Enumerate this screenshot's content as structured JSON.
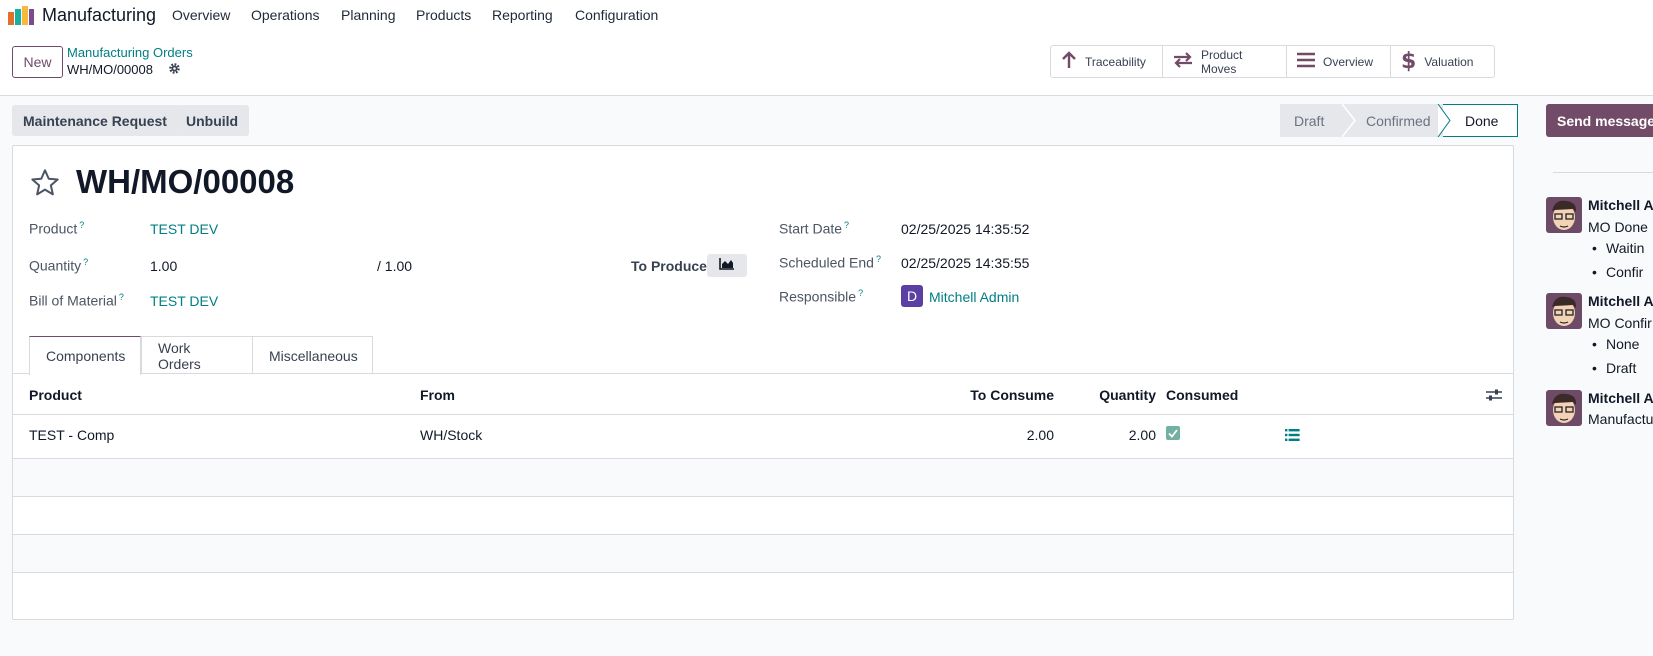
{
  "navbar": {
    "app_name": "Manufacturing",
    "menu": [
      "Overview",
      "Operations",
      "Planning",
      "Products",
      "Reporting",
      "Configuration"
    ]
  },
  "control_panel": {
    "new_label": "New",
    "breadcrumb_parent": "Manufacturing Orders",
    "breadcrumb_current": "WH/MO/00008",
    "smart_buttons": [
      {
        "label": "Traceability",
        "icon": "arrow-up-icon"
      },
      {
        "label": "Product Moves",
        "icon": "arrows-exchange-icon"
      },
      {
        "label": "Overview",
        "icon": "list-lines-icon"
      },
      {
        "label": "Valuation",
        "icon": "dollar-icon"
      }
    ]
  },
  "actions": {
    "maintenance_request": "Maintenance Request",
    "unbuild": "Unbuild",
    "send_message": "Send message"
  },
  "statusbar": {
    "stages": [
      "Draft",
      "Confirmed",
      "Done"
    ],
    "current": "Done"
  },
  "form": {
    "title": "WH/MO/00008",
    "product_label": "Product",
    "product_value": "TEST DEV",
    "quantity_label": "Quantity",
    "quantity_value": "1.00",
    "quantity_total": "/ 1.00",
    "to_produce_label": "To Produce",
    "bom_label": "Bill of Material",
    "bom_value": "TEST DEV",
    "start_date_label": "Start Date",
    "start_date_value": "02/25/2025 14:35:52",
    "scheduled_end_label": "Scheduled End",
    "scheduled_end_value": "02/25/2025 14:35:55",
    "responsible_label": "Responsible",
    "responsible_initial": "D",
    "responsible_value": "Mitchell Admin",
    "help_mark": "?"
  },
  "tabs": [
    "Components",
    "Work Orders",
    "Miscellaneous"
  ],
  "components_table": {
    "headers": [
      "Product",
      "From",
      "To Consume",
      "Quantity",
      "Consumed"
    ],
    "rows": [
      {
        "product": "TEST - Comp",
        "from": "WH/Stock",
        "to_consume": "2.00",
        "quantity": "2.00",
        "consumed": true
      }
    ]
  },
  "chatter": {
    "messages": [
      {
        "author": "Mitchell Ac",
        "body": "MO Done",
        "bullets": [
          "Waitin",
          "Confir"
        ]
      },
      {
        "author": "Mitchell Ac",
        "body": "MO Confir",
        "bullets": [
          "None",
          "Draft"
        ]
      },
      {
        "author": "Mitchell Ac",
        "body": "Manufactu",
        "bullets": []
      }
    ]
  },
  "colors": {
    "brand": "#714b67",
    "link": "#017e84",
    "avatar_d": "#5b3fa3"
  }
}
